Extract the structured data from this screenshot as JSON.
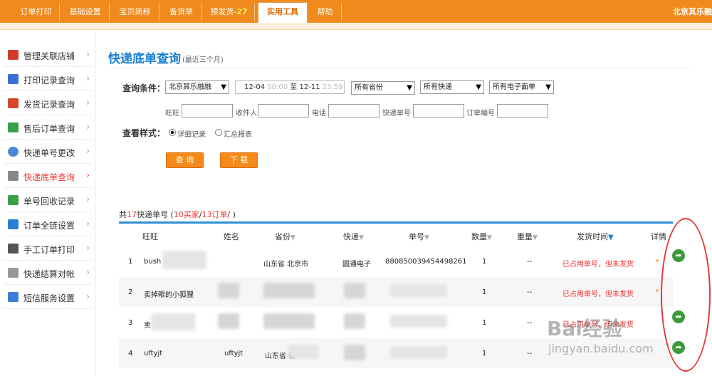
{
  "topnav": {
    "tabs": [
      {
        "label": "订单打印",
        "prefix": ""
      },
      {
        "label": "基础设置",
        "prefix": ""
      },
      {
        "label": "宝贝简称",
        "prefix": ""
      },
      {
        "label": "备货单",
        "prefix": ""
      },
      {
        "label": "预发货",
        "prefix": "预发货-",
        "count": "27"
      },
      {
        "label": "实用工具",
        "prefix": ""
      },
      {
        "label": "帮助",
        "prefix": ""
      }
    ],
    "account": "北京其乐融"
  },
  "sidebar": {
    "items": [
      {
        "label": "管理关联店铺",
        "icon": "dice-icon",
        "color": "#d43a2a"
      },
      {
        "label": "打印记录查询",
        "icon": "print-record-icon",
        "color": "#3a6fd4"
      },
      {
        "label": "发货记录查询",
        "icon": "shipping-record-icon",
        "color": "#d4482a"
      },
      {
        "label": "售后订单查询",
        "icon": "after-sale-icon",
        "color": "#3aa04a"
      },
      {
        "label": "快递单号更改",
        "icon": "express-change-icon",
        "color": "#4a8ad4"
      },
      {
        "label": "快递底单查询",
        "icon": "express-base-icon",
        "color": "#888888"
      },
      {
        "label": "单号回收记录",
        "icon": "recycle-icon",
        "color": "#3aa04a"
      },
      {
        "label": "订单全链设置",
        "icon": "chain-settings-icon",
        "color": "#2a7fd4"
      },
      {
        "label": "手工订单打印",
        "icon": "manual-print-icon",
        "color": "#555555"
      },
      {
        "label": "快递结算对帐",
        "icon": "settlement-icon",
        "color": "#888888"
      },
      {
        "label": "短信服务设置",
        "icon": "sms-icon",
        "color": "#3a7fd4"
      }
    ],
    "arrow": "›"
  },
  "main": {
    "title": "快递底单查询",
    "subtitle": "(最近三个月)",
    "query_label": "查询条件：",
    "shop_select": "北京其乐融融",
    "date_from": "12-04",
    "time_from": "00:00",
    "date_sep": "至",
    "date_to": "12-11",
    "time_to": "23:59",
    "province_select": "所有省份",
    "express_select": "所有快递",
    "waybill_select": "所有电子面单",
    "fields": {
      "wangwang": "旺旺",
      "receiver": "收件人",
      "phone": "电话",
      "express_no": "快递单号",
      "order_no": "订单编号"
    },
    "view_label": "查看样式：",
    "view_detail": "详细记录",
    "view_summary": "汇总报表",
    "query_button": "查 询",
    "download_button": "下 载",
    "summary": {
      "prefix": "共",
      "total": "17",
      "mid1": "快递单号 (",
      "buyers": "10买家",
      "slash": "/",
      "orders": "13订单",
      "suffix": "/ )"
    }
  },
  "table": {
    "headers": [
      "旺旺",
      "姓名",
      "省份",
      "快递",
      "单号",
      "数量",
      "重量",
      "发货时间",
      "详情"
    ],
    "sort_glyph": "▼",
    "rows": [
      {
        "idx": "1",
        "wangwang": "bush",
        "name": "",
        "province": "山东省 北京市",
        "express": "圆通电子",
        "number": "880850039454498261",
        "qty": "1",
        "weight": "--",
        "status": "已占用单号，但未发货"
      },
      {
        "idx": "2",
        "wangwang": "卖掉眼的小狐狸",
        "name": "",
        "province": "",
        "express": "",
        "number": "",
        "qty": "1",
        "weight": "--",
        "status": "已占用单号，但未发货"
      },
      {
        "idx": "3",
        "wangwang": "卖",
        "name": "",
        "province": "",
        "express": "",
        "number": "",
        "qty": "1",
        "weight": "--",
        "status": "已占用单号，但未发货"
      },
      {
        "idx": "4",
        "wangwang": "uftyjt",
        "name": "uftyjt",
        "province": "山东省 德",
        "express": "",
        "number": "",
        "qty": "1",
        "weight": "--",
        "status": ""
      }
    ],
    "detail_glyph": "»",
    "action_glyph": "➦"
  },
  "watermark": {
    "text": "Bai经验",
    "sub": "jingyan.baidu.com"
  },
  "colors": {
    "nav": "#f08a1c",
    "accent_blue": "#1a7fd1",
    "status_red": "#e33333",
    "action_green": "#3c9a3c",
    "annotation_red": "#e23a3a"
  }
}
